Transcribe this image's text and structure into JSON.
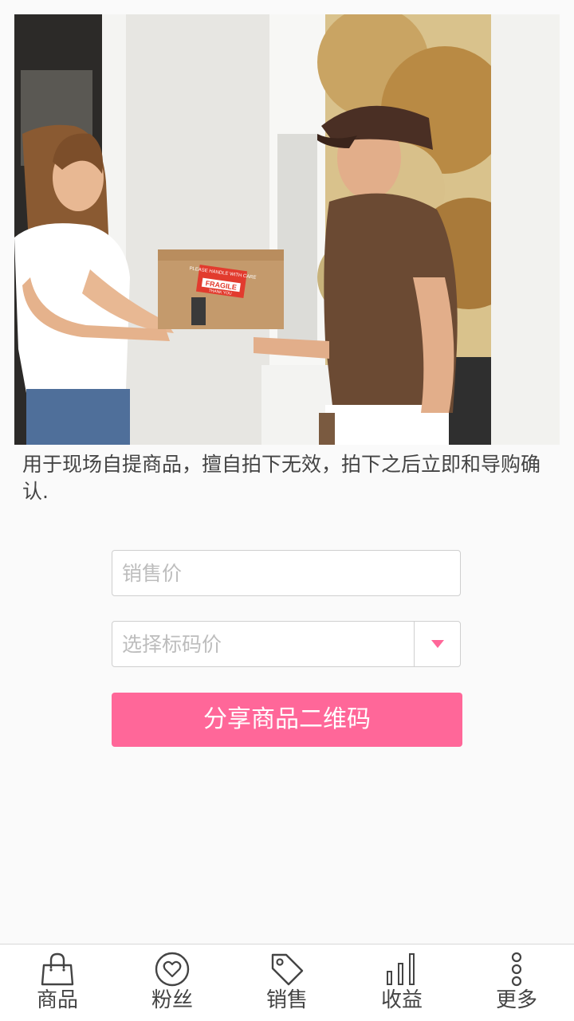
{
  "hero": {
    "box_label_top": "PLEASE HANDLE WITH CARE",
    "box_label_main": "FRAGILE",
    "box_label_bottom": "THANK YOU"
  },
  "description": "用于现场自提商品，擅自拍下无效，拍下之后立即和导购确认.",
  "form": {
    "price_placeholder": "销售价",
    "tag_price_placeholder": "选择标码价",
    "share_button_label": "分享商品二维码"
  },
  "colors": {
    "accent": "#ff6799"
  },
  "tabbar": {
    "items": [
      {
        "label": "商品",
        "icon": "shopping-bag-icon"
      },
      {
        "label": "粉丝",
        "icon": "heart-icon"
      },
      {
        "label": "销售",
        "icon": "tag-icon"
      },
      {
        "label": "收益",
        "icon": "bar-chart-icon"
      },
      {
        "label": "更多",
        "icon": "more-icon"
      }
    ]
  }
}
